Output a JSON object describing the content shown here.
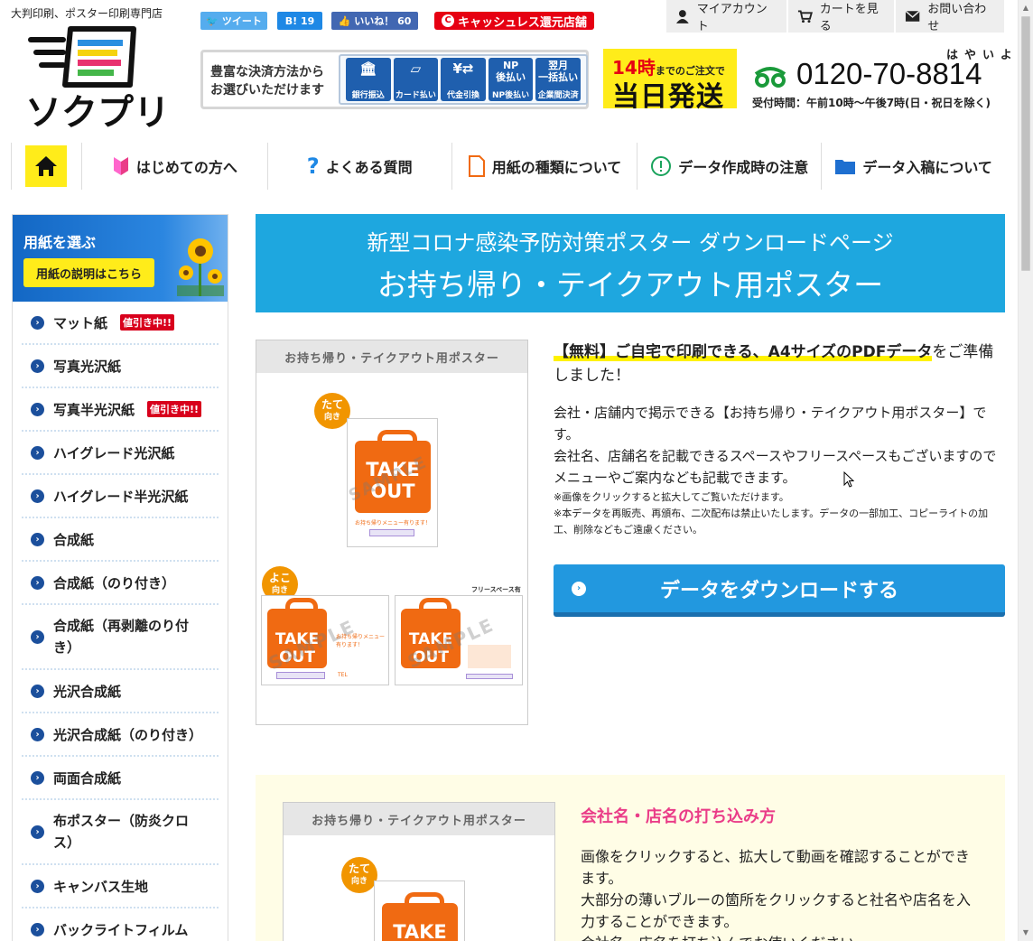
{
  "header": {
    "tagline": "大判印刷、ポスター印刷専門店",
    "logo_text": "ソクプリ",
    "social": {
      "tweet": "ツイート",
      "hatena": "B! 19",
      "like": "いいね！ 60",
      "cashless": "キャッシュレス還元店舗"
    },
    "top_links": [
      "マイアカウント",
      "カートを見る",
      "お問い合わせ"
    ],
    "payment": {
      "text_line1": "豊富な決済方法から",
      "text_line2": "お選びいただけます",
      "methods": [
        {
          "icon": "bank-icon",
          "glyph": "🏛",
          "label": "銀行振込"
        },
        {
          "icon": "card-icon",
          "glyph": "▭",
          "label": "カード払い"
        },
        {
          "icon": "cod-icon",
          "glyph": "¥⇄",
          "label": "代金引換"
        },
        {
          "icon": "np-icon",
          "glyph": "NP\n後払い",
          "label": "NP後払い"
        },
        {
          "icon": "monthly-icon",
          "glyph": "翌月\n一括払い",
          "label": "企業間決済"
        }
      ]
    },
    "shipping": {
      "hour": "14時",
      "line1_rest": "までのご注文で",
      "line2": "当日発送"
    },
    "phone": {
      "ruby": "はやいよ",
      "number": "0120-70-8814",
      "hours": "受付時間：午前10時〜午後7時(日・祝日を除く)"
    }
  },
  "nav": {
    "items": [
      "はじめての方へ",
      "よくある質問",
      "用紙の種類について",
      "データ作成時の注意",
      "データ入稿について"
    ]
  },
  "sidebar": {
    "title": "用紙を選ぶ",
    "button": "用紙の説明はこちら",
    "sale_badge": "値引き中!!",
    "items": [
      {
        "label": "マット紙",
        "sale": true
      },
      {
        "label": "写真光沢紙",
        "sale": false
      },
      {
        "label": "写真半光沢紙",
        "sale": true
      },
      {
        "label": "ハイグレード光沢紙",
        "sale": false
      },
      {
        "label": "ハイグレード半光沢紙",
        "sale": false
      },
      {
        "label": "合成紙",
        "sale": false
      },
      {
        "label": "合成紙（のり付き）",
        "sale": false
      },
      {
        "label": "合成紙（再剥離のり付き）",
        "sale": false
      },
      {
        "label": "光沢合成紙",
        "sale": false
      },
      {
        "label": "光沢合成紙（のり付き）",
        "sale": false
      },
      {
        "label": "両面合成紙",
        "sale": false
      },
      {
        "label": "布ポスター（防炎クロス）",
        "sale": false
      },
      {
        "label": "キャンバス生地",
        "sale": false
      },
      {
        "label": "バックライトフィルム",
        "sale": false
      }
    ]
  },
  "main": {
    "banner_sub": "新型コロナ感染予防対策ポスター ダウンロードページ",
    "banner_title": "お持ち帰り・テイクアウト用ポスター",
    "thumb_title": "お持ち帰り・テイクアウト用ポスター",
    "poster": {
      "tate_1": "たて",
      "tate_2": "向き",
      "yoko_1": "よこ",
      "yoko_2": "向き",
      "take": "TAKE",
      "out": "OUT",
      "sample": "SAMPLE",
      "menu_line": "お持ち帰りメニュー有ります！",
      "free_space": "フリースペース有",
      "tel": "TEL"
    },
    "lead_highlight": "【無料】ご自宅で印刷できる、A4サイズのPDFデータ",
    "lead_rest": "をご準備しました！",
    "desc": "会社・店舗内で掲示できる【お持ち帰り・テイクアウト用ポスター】です。\n会社名、店舗名を記載できるスペースやフリースペースもございますのでメニューやご案内なども記載できます。",
    "note1": "※画像をクリックすると拡大してご覧いただけます。",
    "note2": "※本データを再販売、再頒布、二次配布は禁止いたします。データの一部加工、コピーライトの加工、削除などもご遠慮ください。",
    "download_button": "データをダウンロードする",
    "section2_title": "会社名・店名の打ち込み方",
    "section2_text": "画像をクリックすると、拡大して動画を確認することができます。\n大部分の薄いブルーの箇所をクリックすると社名や店名を入力することができます。\n会社名、店名を打ち込んでお使いください。"
  },
  "colors": {
    "accent_blue": "#1ea7df",
    "yellow": "#ffec1a",
    "orange": "#f06a12",
    "pink": "#ea3c88",
    "sale_red": "#d8001c"
  }
}
